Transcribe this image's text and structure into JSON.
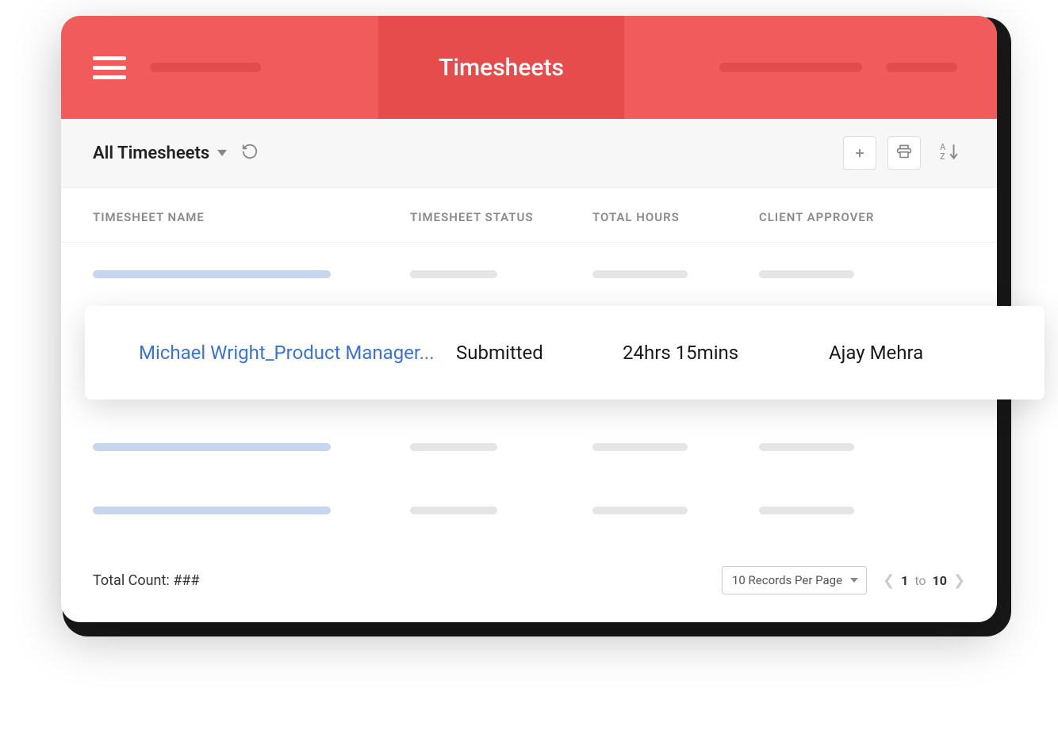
{
  "header": {
    "title": "Timesheets"
  },
  "toolbar": {
    "filter_label": "All Timesheets"
  },
  "table": {
    "columns": {
      "name": "TIMESHEET NAME",
      "status": "TIMESHEET STATUS",
      "hours": "TOTAL HOURS",
      "approver": "CLIENT APPROVER"
    },
    "highlighted_row": {
      "name": "Michael Wright_Product Manager...",
      "status": "Submitted",
      "hours": "24hrs 15mins",
      "approver": "Ajay Mehra"
    }
  },
  "footer": {
    "total_count_label": "Total Count: ###",
    "records_per_page": "10 Records Per Page",
    "page_from": "1",
    "page_to_word": "to",
    "page_to": "10"
  }
}
